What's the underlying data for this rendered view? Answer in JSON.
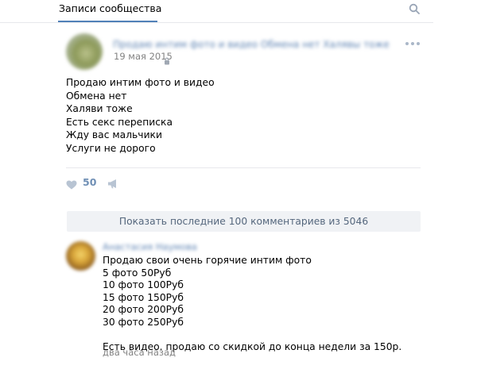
{
  "header": {
    "tab_label": "Записи сообщества",
    "search_icon": "search-icon"
  },
  "post": {
    "author_blurred": "Продаю интим фото и видео Обмена нет Халявы тоже",
    "date": "19 мая 2015",
    "lines": [
      "Продаю интим фото и видео",
      "Обмена нет",
      "Халяви тоже",
      "Есть секс переписка",
      "Жду вас мальчики",
      "Услуги не дорого"
    ],
    "likes": "50"
  },
  "comments_toggle": "Показать последние 100 комментариев из 5046",
  "comment": {
    "author_blurred": "Анастасия Наумова",
    "lines": [
      "Продаю свои очень горячие интим фото",
      "5 фото 50Руб",
      "10 фото 100Руб",
      "15 фото 150Руб",
      "20 фото 200Руб",
      "30 фото 250Руб"
    ],
    "extra": "Есть видео. продаю со скидкой до конца недели за 150р.",
    "time": "два часа назад"
  },
  "colors": {
    "accent": "#5181b8",
    "link_blurred": "#5f84b3",
    "muted": "#828282",
    "button_bg": "#f0f2f5",
    "button_text": "#55677d",
    "icon": "#aab7c8"
  }
}
